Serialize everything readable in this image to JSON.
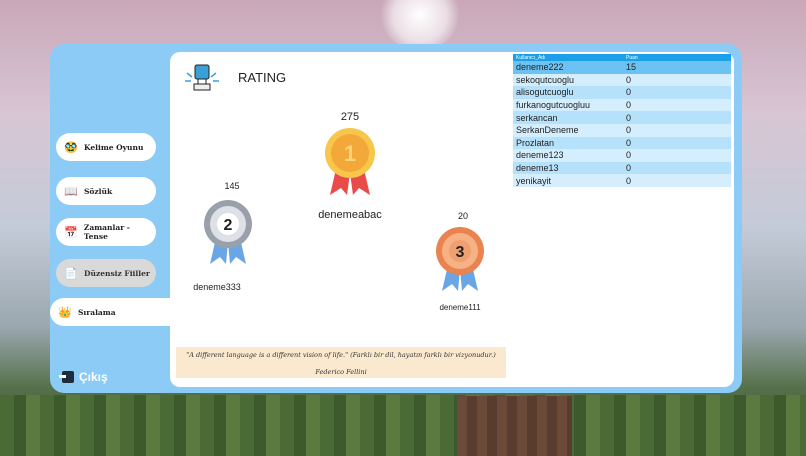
{
  "sidebar": {
    "items": [
      {
        "label": "Kelime Oyunu",
        "icon": "glasses-icon"
      },
      {
        "label": "Sözlük",
        "icon": "book-icon"
      },
      {
        "label": "Zamanlar - Tense",
        "icon": "calendar-icon"
      },
      {
        "label": "Düzensiz Fiiller",
        "icon": "document-icon"
      },
      {
        "label": "Sıralama",
        "icon": "crown-icon"
      }
    ],
    "logout_label": "Çıkış"
  },
  "main": {
    "title": "RATING"
  },
  "podium": {
    "first": {
      "rank": "1",
      "score": "275",
      "name": "denemeabac",
      "color": "#f2b43a"
    },
    "second": {
      "rank": "2",
      "score": "145",
      "name": "deneme333",
      "color": "#b8bcc4"
    },
    "third": {
      "rank": "3",
      "score": "20",
      "name": "deneme111",
      "color": "#f0a070"
    }
  },
  "leaderboard": {
    "headers": [
      "Kullanıcı_Adı",
      "Puan"
    ],
    "rows": [
      [
        "deneme222",
        "15"
      ],
      [
        "sekoqutcuoglu",
        "0"
      ],
      [
        "alisogutcuoglu",
        "0"
      ],
      [
        "furkanogutcuogluu",
        "0"
      ],
      [
        "serkancan",
        "0"
      ],
      [
        "SerkanDeneme",
        "0"
      ],
      [
        "Prozlatan",
        "0"
      ],
      [
        "deneme123",
        "0"
      ],
      [
        "deneme13",
        "0"
      ],
      [
        "yenikayit",
        "0"
      ]
    ]
  },
  "quote": {
    "text": "\"A different language is a different vision of life.\" (Farklı bir dil, hayatın farklı bir vizyonudur.)",
    "author": "Federico Fellini"
  }
}
